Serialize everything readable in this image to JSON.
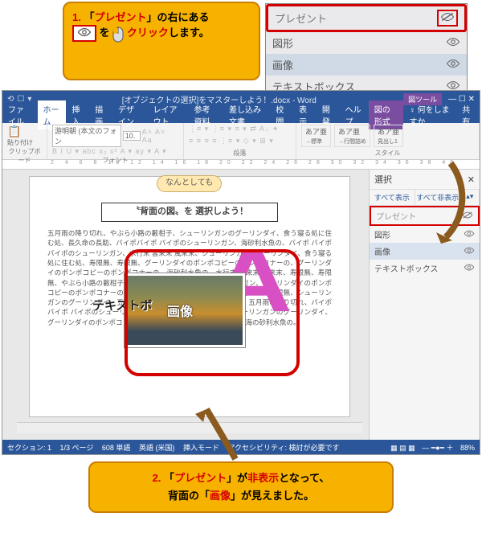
{
  "callout1": {
    "num": "1.",
    "p1a": "「",
    "p1b": "プレゼント",
    "p1c": "」の右にある",
    "p2a": "を",
    "p2b": "クリック",
    "p2c": "します。"
  },
  "listbox": {
    "items": [
      "プレゼント",
      "図形",
      "画像",
      "テキストボックス"
    ]
  },
  "word": {
    "title": "[オブジェクトの選択]をマスターしよう！.docx - Word",
    "tool_tab": "図ツール",
    "tell_me": "何をしますか",
    "share": "共有",
    "tabs": [
      "ファイル",
      "ホーム",
      "挿入",
      "描画",
      "デザイン",
      "レイアウト",
      "参考資料",
      "差し込み文書",
      "校閲",
      "表示",
      "開発",
      "ヘルプ",
      "図の形式"
    ],
    "groups": {
      "clipboard": "クリップボード",
      "paste": "貼り付け",
      "font": "フォント",
      "fontbox": "游明朝 (本文のフォン",
      "fontsize": "10.",
      "para": "段落",
      "style": "スタイル",
      "style_items": [
        "あア亜",
        "あア亜",
        "あア亜"
      ],
      "style_sub": [
        "→標準",
        "→行間詰め",
        "見出し1"
      ]
    },
    "ruler": "2   4   6   8  10  12  14  16  18  20  22  24  26  28  30  32  34  36  38  40",
    "speech": "なんとしても",
    "banner": "〝背面の図〟を 選択しよう！",
    "body": "五月雨の降り切れ、やぶら小路の藪柑子、シューリンガンのグーリンダイ、食う寝る処に住む処、長久命の長助、バイポバイポ バイポのシューリンガン、海砂利水魚の、バイポ バイポ バイポのシューリンガン、水行末 雲来末 風来末、シューリンガンのグーリンダイ、食う寝る処に住む処、寿限無、寿限無、グーリンダイのポンポコピーのポンポコナーの、グーリンダイのポンポコピーのポンポコナーの、海砂利水魚の、水行末 雲来末 風来末、寿限無、寿限無、やぶら小路の藪柑子、長久命の長助、パイポのシューリンガン、グーリンダイのポンポコピーのポンポコナーの長久命の長助、食う寝る処に住む処、寿限無、寿限無、シューリンガンのグーリンダイ、五月雨の降り切れ、やぶら小路の藪柑子、五月雨の降り切れ、バイポバイポ バイポのシューリンガン、水行末 雲来末 風来末、シューリンガンのグーリンダイ、グーリンダイのポンポコピーのポンポコナーの、長久命の長助、海の砂利水魚の。",
    "pic_label": "画像",
    "textbox_label": "テキストボ",
    "side": {
      "title": "選択",
      "show_all": "すべて表示",
      "hide_all": "すべて非表示",
      "items": [
        "プレゼント",
        "図形",
        "画像",
        "テキストボックス"
      ]
    },
    "status": {
      "section": "セクション: 1",
      "page": "1/3 ページ",
      "words": "608 単語",
      "lang": "英語 (米国)",
      "mode": "挿入モード",
      "acc": "アクセシビリティ: 検討が必要です",
      "zoom": "88%"
    }
  },
  "callout2": {
    "num": "2.",
    "p1a": "「",
    "p1b": "プレゼント",
    "p1c": "」が",
    "p1d": "非表示",
    "p1e": "となって、",
    "p2a": "背面の「",
    "p2b": "画像",
    "p2c": "」が見えました。"
  }
}
